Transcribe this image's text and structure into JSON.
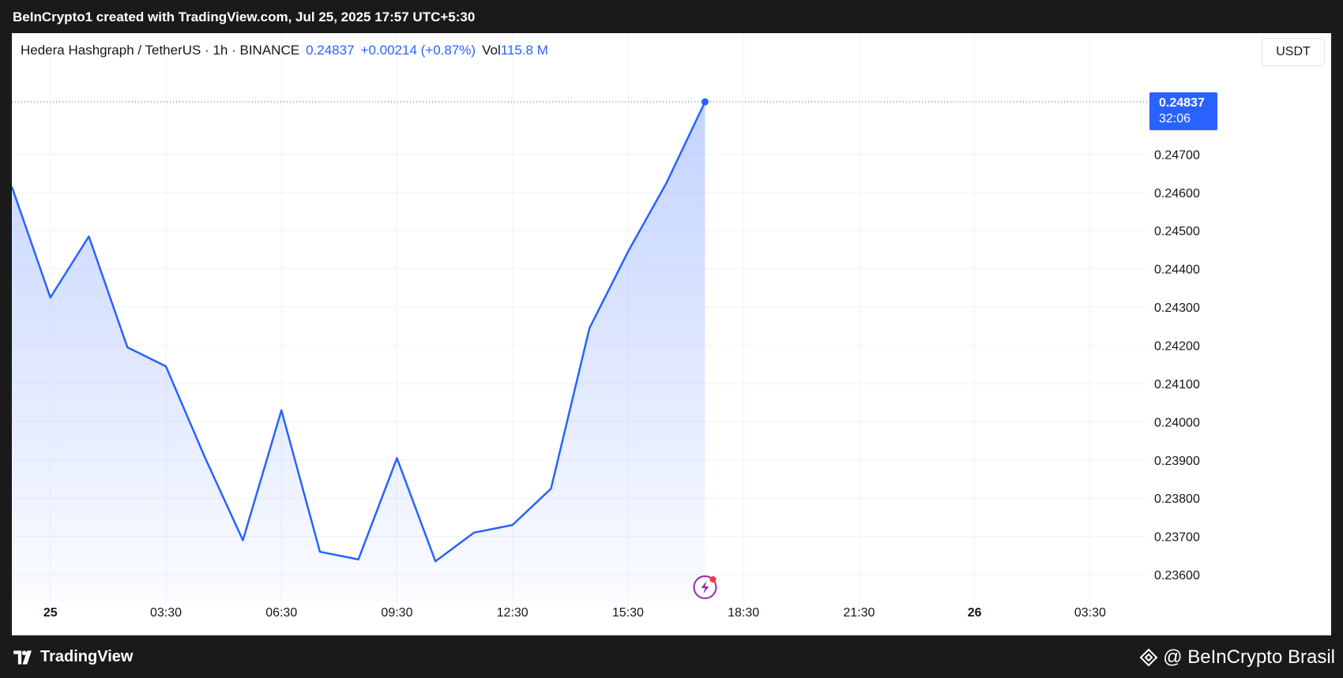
{
  "header": {
    "attribution": "BeInCrypto1 created with TradingView.com, Jul 25, 2025 17:57 UTC+5:30"
  },
  "legend": {
    "symbol": "Hedera Hashgraph / TetherUS · 1h · BINANCE",
    "price": "0.24837",
    "change": "+0.00214 (+0.87%)",
    "vol_label": "Vol",
    "vol_value": "115.8 M"
  },
  "unit_label": "USDT",
  "footer": {
    "tv_brand": "TradingView",
    "watermark": "@ BeInCrypto Brasil"
  },
  "colors": {
    "line": "#2962ff",
    "fill": "#2962ff",
    "grid": "#f0f3fa",
    "axis_text": "#131722",
    "badge_bg": "#2962ff",
    "lightning": "#9c27b0",
    "alert_dot": "#f23645"
  },
  "last_price_badge": {
    "price": "0.24837",
    "countdown": "32:06"
  },
  "chart_data": {
    "type": "area",
    "x_ticks": [
      "25",
      "03:30",
      "06:30",
      "09:30",
      "12:30",
      "15:30",
      "18:30",
      "21:30",
      "26",
      "03:30"
    ],
    "x_tick_bold": [
      true,
      false,
      false,
      false,
      false,
      false,
      false,
      false,
      true,
      false
    ],
    "y_ticks": [
      "0.24700",
      "0.24600",
      "0.24500",
      "0.24400",
      "0.24300",
      "0.24200",
      "0.24100",
      "0.24000",
      "0.23900",
      "0.23800",
      "0.23700",
      "0.23600"
    ],
    "y_tick_values": [
      0.247,
      0.246,
      0.245,
      0.244,
      0.243,
      0.242,
      0.241,
      0.24,
      0.239,
      0.238,
      0.237,
      0.236
    ],
    "series": [
      {
        "x": [
          "Jul 24 23:30",
          "Jul 25 00:30",
          "Jul 25 01:30",
          "Jul 25 02:30",
          "Jul 25 03:30",
          "Jul 25 04:30",
          "Jul 25 05:30",
          "Jul 25 06:30",
          "Jul 25 07:30",
          "Jul 25 08:30",
          "Jul 25 09:30",
          "Jul 25 10:30",
          "Jul 25 11:30",
          "Jul 25 12:30",
          "Jul 25 13:30",
          "Jul 25 14:30",
          "Jul 25 15:30",
          "Jul 25 16:30",
          "Jul 25 17:30"
        ],
        "values": [
          0.24615,
          0.24325,
          0.24485,
          0.24195,
          0.24145,
          0.2391,
          0.2369,
          0.2403,
          0.2366,
          0.2364,
          0.23905,
          0.23635,
          0.2371,
          0.2373,
          0.23825,
          0.24245,
          0.24445,
          0.24625,
          0.24837
        ]
      }
    ],
    "x_range": [
      "Jul 24 23:30",
      "Jul 26 05:00"
    ],
    "ylim": [
      0.2353,
      0.2493
    ],
    "last_value": 0.24837,
    "grid": true
  }
}
